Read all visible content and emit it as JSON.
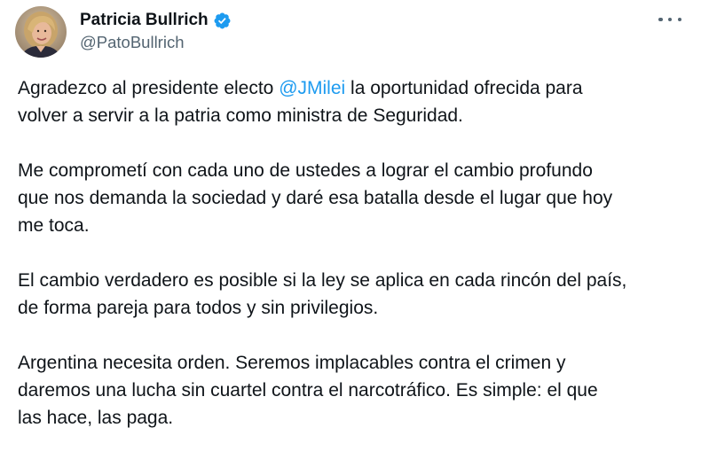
{
  "author": {
    "display_name": "Patricia Bullrich",
    "handle": "@PatoBullrich",
    "verified": true,
    "verified_color": "#1d9bf0",
    "avatar_icon": "profile-photo"
  },
  "menu": {
    "icon": "more-horizontal-icon"
  },
  "tweet": {
    "p1": {
      "l1_before": "Agradezco al presidente electo ",
      "mention": "@JMilei",
      "l1_after": " la oportunidad ofrecida para",
      "l2": "volver a servir a la patria como ministra de Seguridad."
    },
    "p2": {
      "l1": "Me comprometí con cada uno de ustedes a lograr el cambio profundo",
      "l2": "que nos demanda la sociedad y daré esa batalla desde el lugar que hoy",
      "l3": "me toca."
    },
    "p3": {
      "l1": "El cambio verdadero es posible si la ley se aplica en cada rincón del país,",
      "l2": "de forma pareja para todos y sin privilegios."
    },
    "p4": {
      "l1": "Argentina necesita orden. Seremos implacables contra el crimen y",
      "l2": "daremos una lucha sin cuartel contra el narcotráfico. Es simple: el que",
      "l3": "las hace, las paga."
    }
  },
  "colors": {
    "text": "#0f1419",
    "secondary": "#536471",
    "link": "#1d9bf0",
    "background": "#ffffff"
  }
}
